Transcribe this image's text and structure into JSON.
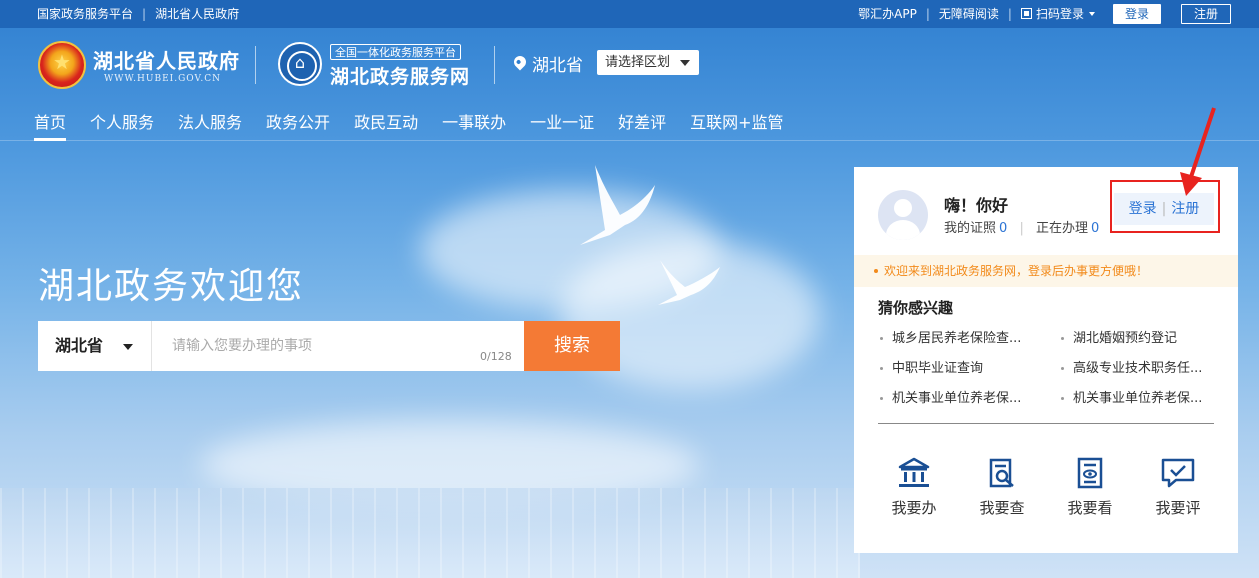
{
  "topbar": {
    "left_links": [
      "国家政务服务平台",
      "湖北省人民政府"
    ],
    "app_label": "鄂汇办APP",
    "accessibility_label": "无障碍阅读",
    "qr_login_label": "扫码登录",
    "login_label": "登录",
    "register_label": "注册"
  },
  "header": {
    "site_name": "湖北省人民政府",
    "site_url": "WWW.HUBEI.GOV.CN",
    "platform_tag": "全国一体化政务服务平台",
    "platform_name": "湖北政务服务网",
    "location": "湖北省",
    "region_select": "请选择区划"
  },
  "nav": {
    "items": [
      "首页",
      "个人服务",
      "法人服务",
      "政务公开",
      "政民互动",
      "一事联办",
      "一业一证",
      "好差评",
      "互联网+监管"
    ]
  },
  "hero": {
    "title": "湖北政务欢迎您",
    "search_scope": "湖北省",
    "search_placeholder": "请输入您要办理的事项",
    "search_count": "0/128",
    "search_button": "搜索"
  },
  "panel": {
    "greeting": "嗨！你好",
    "my_cert_label": "我的证照",
    "my_cert_count": "0",
    "in_progress_label": "正在办理",
    "in_progress_count": "0",
    "login_label": "登录",
    "register_label": "注册",
    "notice": "欢迎来到湖北政务服务网，登录后办事更方便哦！",
    "interest_title": "猜你感兴趣",
    "interests": [
      "城乡居民养老保险查...",
      "湖北婚姻预约登记",
      "中职毕业证查询",
      "高级专业技术职务任...",
      "机关事业单位养老保...",
      "机关事业单位养老保..."
    ],
    "actions": [
      {
        "label": "我要办",
        "icon": "government-building-icon"
      },
      {
        "label": "我要查",
        "icon": "document-search-icon"
      },
      {
        "label": "我要看",
        "icon": "view-document-icon"
      },
      {
        "label": "我要评",
        "icon": "review-chat-icon"
      }
    ]
  },
  "colors": {
    "brand_blue": "#1f66b8",
    "search_orange": "#f47a35",
    "link_blue": "#2c74d4",
    "notice_orange": "#f28a1a",
    "annotation_red": "#e8231f"
  }
}
